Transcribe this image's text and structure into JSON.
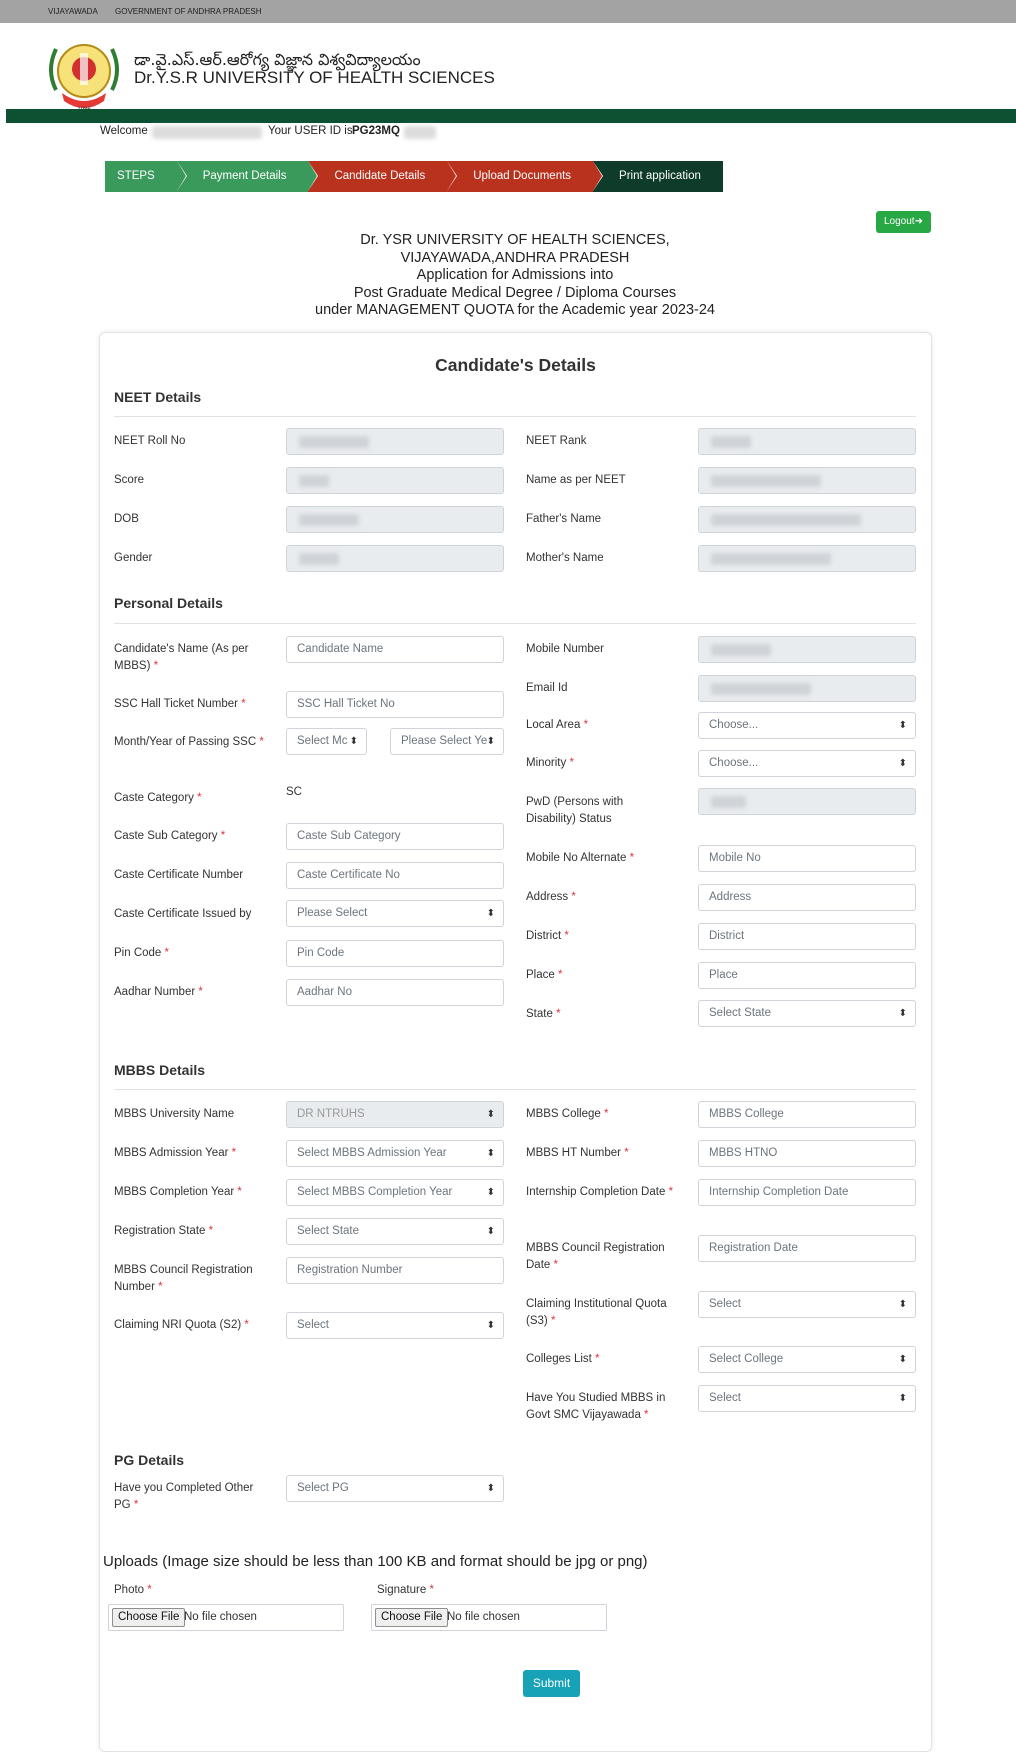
{
  "topbar": {
    "city": "VIJAYAWADA",
    "govt": "GOVERNMENT OF ANDHRA PRADESH"
  },
  "header": {
    "name_telugu": "డా.వై.ఎస్.ఆర్.ఆరోగ్య విజ్ఞాన విశ్వవిద్యాలయం",
    "name_english": "Dr.Y.S.R UNIVERSITY OF HEALTH SCIENCES",
    "logo": "university-emblem-icon"
  },
  "welcome": {
    "prefix": "Welcome",
    "userid_label": "Your USER ID is",
    "userid": "PG23MQ"
  },
  "steps": [
    {
      "label": "STEPS",
      "color": "#3a9a5c"
    },
    {
      "label": "Payment Details",
      "color": "#3a9a5c"
    },
    {
      "label": "Candidate Details",
      "color": "#b8321e"
    },
    {
      "label": "Upload Documents",
      "color": "#b8321e"
    },
    {
      "label": "Print application",
      "color": "#0e3b2a"
    }
  ],
  "logout": {
    "label": "Logout",
    "icon": "sign-out-icon"
  },
  "title": {
    "line1": "Dr. YSR UNIVERSITY OF HEALTH SCIENCES,",
    "line2": "VIJAYAWADA,ANDHRA PRADESH",
    "line3": "Application for Admissions into",
    "line4": "Post Graduate Medical Degree / Diploma Courses",
    "line5": "under MANAGEMENT QUOTA for the Academic year 2023-24"
  },
  "form": {
    "heading": "Candidate's Details",
    "neet": {
      "heading": "NEET Details",
      "roll": "NEET Roll No",
      "rank": "NEET Rank",
      "score": "Score",
      "name": "Name as per NEET",
      "dob": "DOB",
      "father": "Father's Name",
      "gender": "Gender",
      "mother": "Mother's Name"
    },
    "personal": {
      "heading": "Personal Details",
      "cand_name": "Candidate's Name (As per MBBS)",
      "cand_name_ph": "Candidate Name",
      "mobile": "Mobile Number",
      "email": "Email Id",
      "ssc": "SSC Hall Ticket Number",
      "ssc_ph": "SSC Hall Ticket No",
      "local_area": "Local Area",
      "local_area_val": "Choose...",
      "month_year": "Month/Year of Passing SSC",
      "month_val": "Select Mc",
      "year_val": "Please Select Ye",
      "minority": "Minority",
      "minority_val": "Choose...",
      "caste_cat": "Caste Category",
      "caste_cat_val": "SC",
      "pwd": "PwD (Persons with Disability) Status",
      "caste_sub": "Caste Sub Category",
      "caste_sub_ph": "Caste Sub Category",
      "mobile_alt": "Mobile No Alternate",
      "mobile_alt_ph": "Mobile No",
      "caste_cert": "Caste Certificate Number",
      "caste_cert_ph": "Caste Certificate No",
      "address": "Address",
      "address_ph": "Address",
      "caste_issued": "Caste Certificate Issued by",
      "caste_issued_val": "Please Select",
      "district": "District",
      "district_ph": "District",
      "pin": "Pin Code",
      "pin_ph": "Pin Code",
      "place": "Place",
      "place_ph": "Place",
      "aadhar": "Aadhar Number",
      "aadhar_ph": "Aadhar No",
      "state": "State",
      "state_val": "Select State"
    },
    "mbbs": {
      "heading": "MBBS Details",
      "univ": "MBBS University Name",
      "univ_val": "DR NTRUHS",
      "college": "MBBS College",
      "college_ph": "MBBS College",
      "adm_year": "MBBS Admission Year",
      "adm_year_val": "Select MBBS Admission Year",
      "ht": "MBBS HT Number",
      "ht_ph": "MBBS HTNO",
      "comp_year": "MBBS Completion Year",
      "comp_year_val": "Select MBBS Completion Year",
      "intern": "Internship Completion Date",
      "intern_ph": "Internship Completion Date",
      "reg_state": "Registration State",
      "reg_state_val": "Select State",
      "reg_date": "MBBS Council Registration Date",
      "reg_date_ph": "Registration Date",
      "reg_num": "MBBS Council Registration Number",
      "reg_num_ph": "Registration Number",
      "inst_quota": "Claiming Institutional Quota (S3)",
      "inst_quota_val": "Select",
      "nri": "Claiming NRI Quota (S2)",
      "nri_val": "Select",
      "colleges": "Colleges List",
      "colleges_val": "Select College",
      "govt_smc": "Have You Studied MBBS in Govt SMC Vijayawada",
      "govt_smc_val": "Select"
    },
    "pg": {
      "heading": "PG Details",
      "other_pg": "Have you Completed Other PG",
      "other_pg_val": "Select PG"
    },
    "uploads": {
      "heading": "Uploads (Image size should be less than 100 KB and format should be jpg or png)",
      "photo": "Photo",
      "signature": "Signature",
      "choose": "Choose File",
      "no_file": "No file chosen"
    },
    "submit": "Submit",
    "required_mark": "*"
  }
}
